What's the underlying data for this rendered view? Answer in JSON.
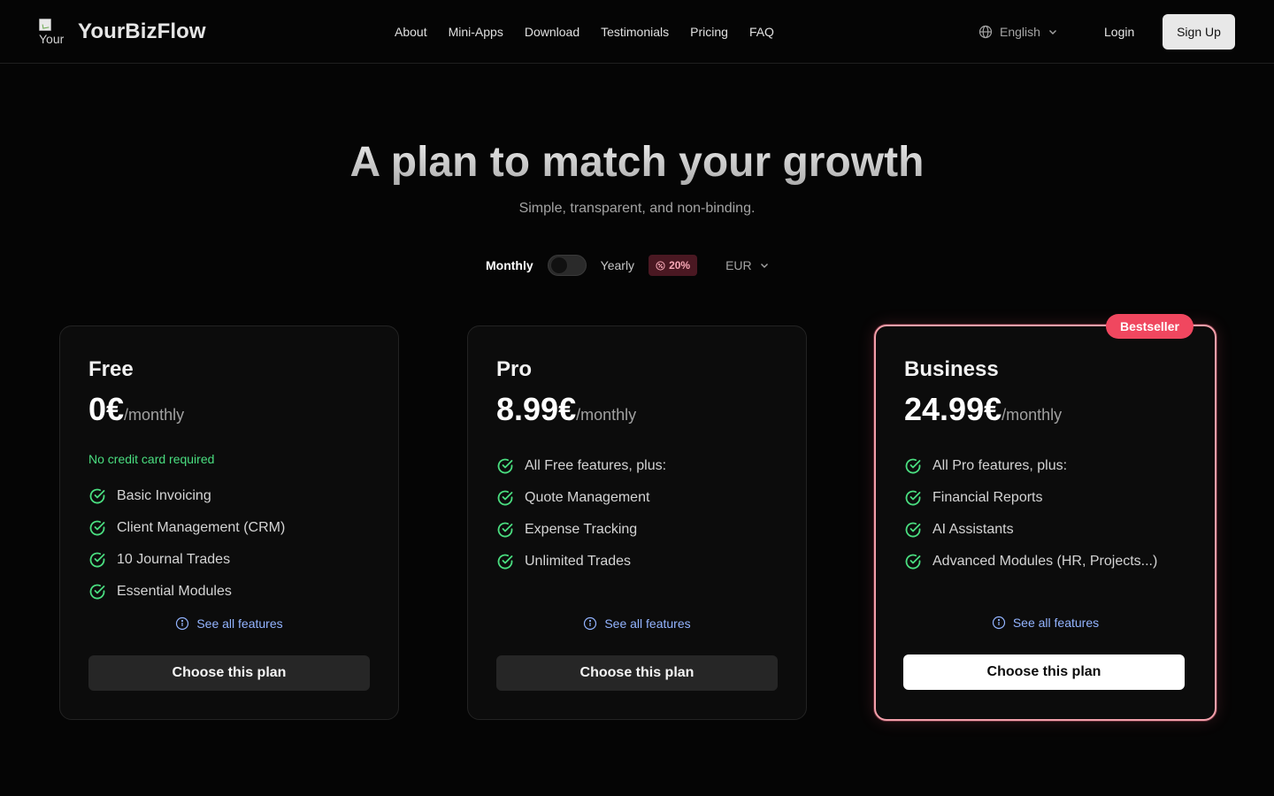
{
  "header": {
    "logo_alt": "Your",
    "brand": "YourBizFlow",
    "nav": [
      "About",
      "Mini-Apps",
      "Download",
      "Testimonials",
      "Pricing",
      "FAQ"
    ],
    "language": "English",
    "login": "Login",
    "signup": "Sign Up"
  },
  "hero": {
    "title": "A plan to match your growth",
    "subtitle": "Simple, transparent, and non-binding."
  },
  "billing": {
    "monthly": "Monthly",
    "yearly": "Yearly",
    "yearly_selected": false,
    "discount": "20%",
    "currency": "EUR"
  },
  "plans": [
    {
      "name": "Free",
      "price": "0€",
      "period": "/monthly",
      "note": "No credit card required",
      "features": [
        "Basic Invoicing",
        "Client Management (CRM)",
        "10 Journal Trades",
        "Essential Modules"
      ],
      "see_all": "See all features",
      "cta": "Choose this plan"
    },
    {
      "name": "Pro",
      "price": "8.99€",
      "period": "/monthly",
      "features": [
        "All Free features, plus:",
        "Quote Management",
        "Expense Tracking",
        "Unlimited Trades"
      ],
      "see_all": "See all features",
      "cta": "Choose this plan"
    },
    {
      "name": "Business",
      "badge": "Bestseller",
      "price": "24.99€",
      "period": "/monthly",
      "features": [
        "All Pro features, plus:",
        "Financial Reports",
        "AI Assistants",
        "Advanced Modules (HR, Projects...)"
      ],
      "see_all": "See all features",
      "cta": "Choose this plan"
    }
  ],
  "colors": {
    "background": "#050505",
    "accent_green": "#4ade80",
    "link_blue": "#93b4ff",
    "badge_red": "#f0475f",
    "highlight_border": "#f2a0aa"
  }
}
